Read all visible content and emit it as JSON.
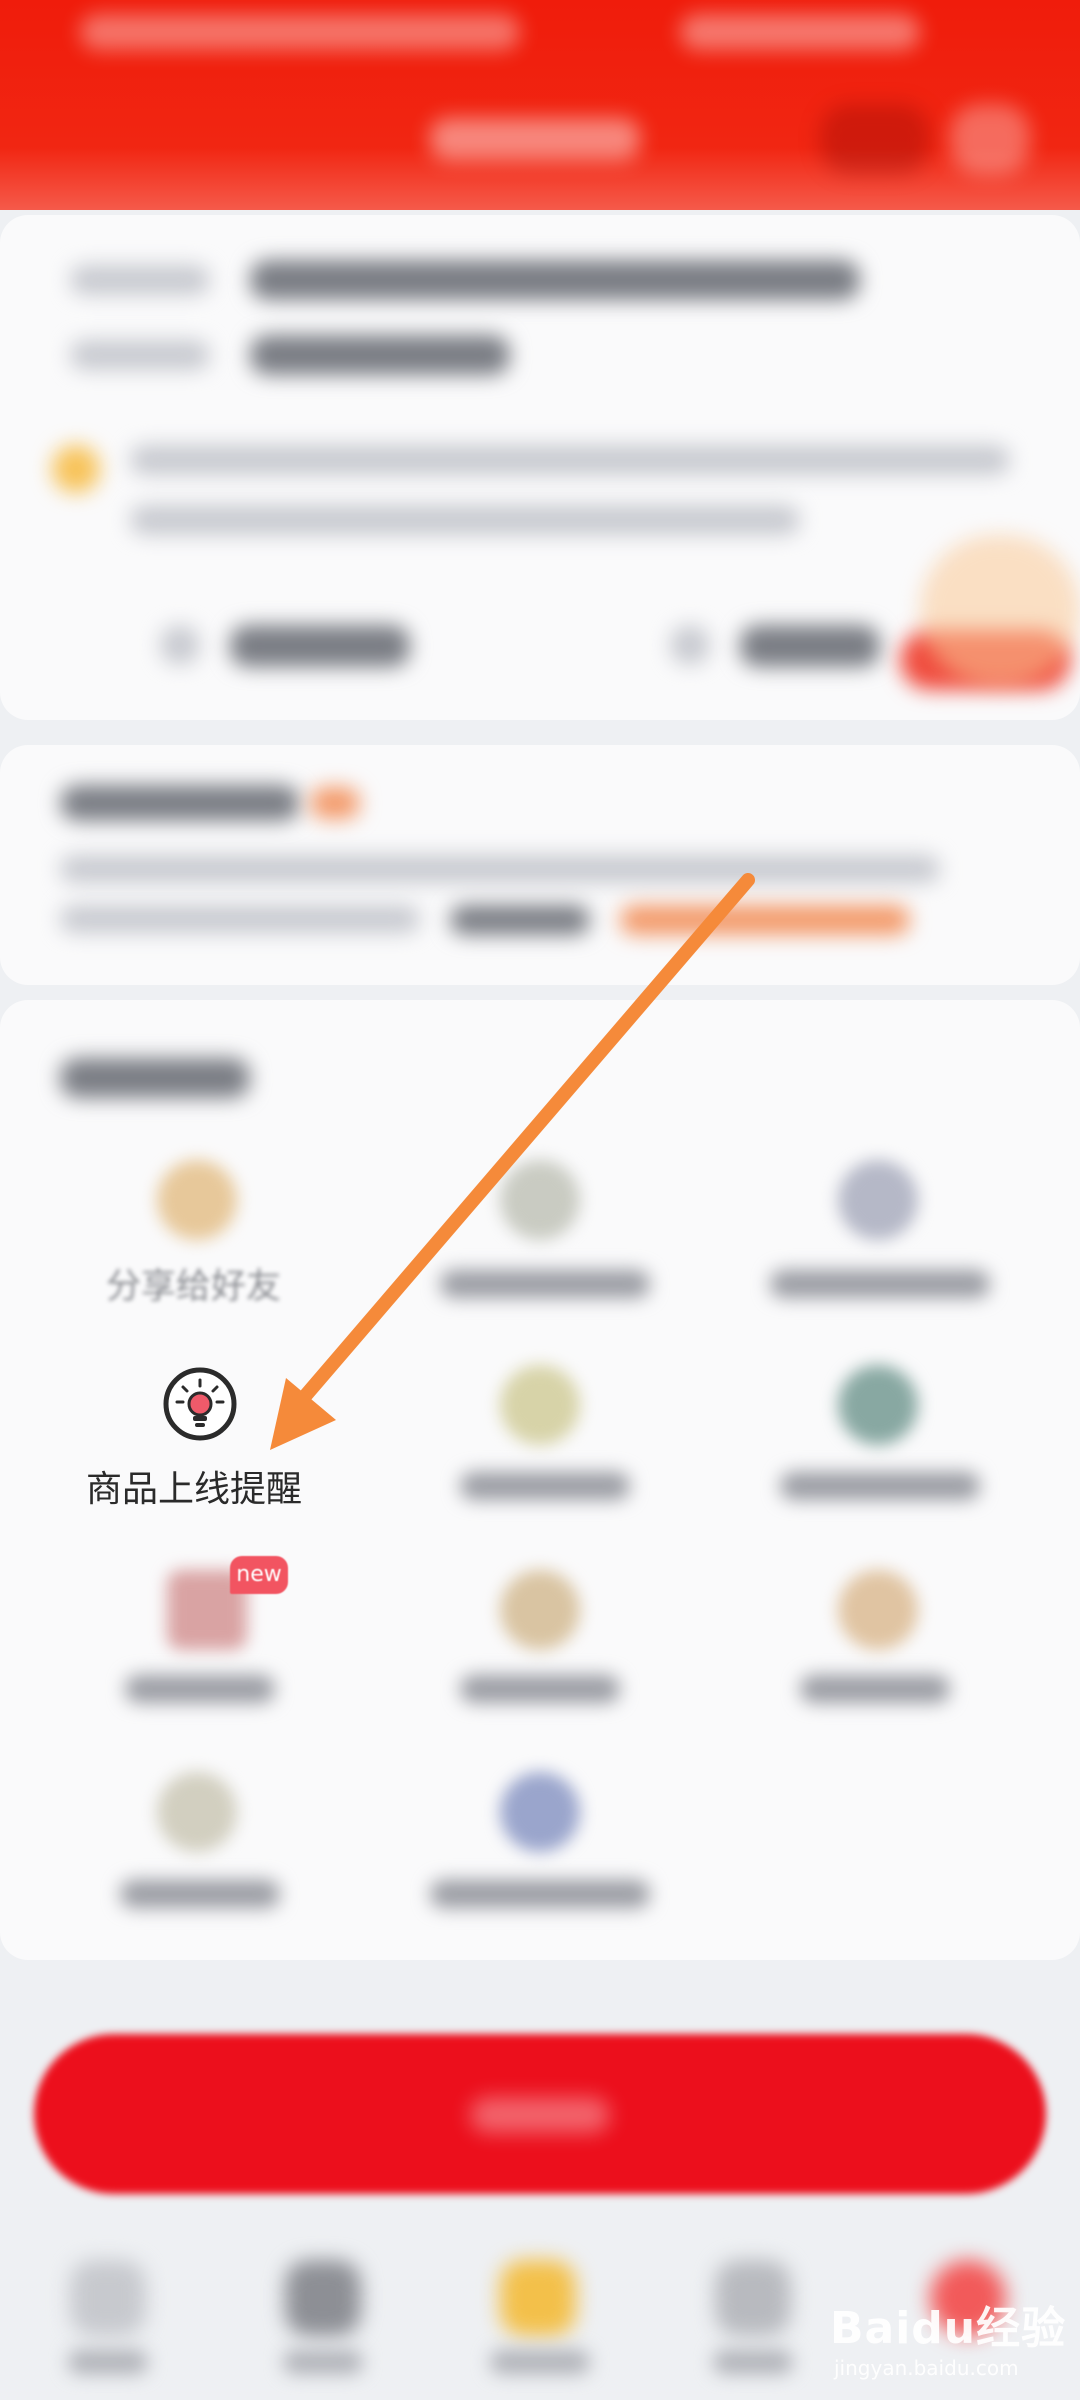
{
  "services": {
    "share_label": "分享给好友",
    "reminder_label": "商品上线提醒",
    "new_badge": "new"
  },
  "watermark": {
    "brand": "Baidu经验",
    "url": "jingyan.baidu.com"
  },
  "colors": {
    "header_red": "#f01c0b",
    "button_red": "#ec0f1c",
    "arrow_orange": "#f58a3a",
    "badge_red": "#f25461"
  },
  "icons": {
    "focused_item": "lightbulb-icon",
    "annotation": "arrow-pointer"
  }
}
